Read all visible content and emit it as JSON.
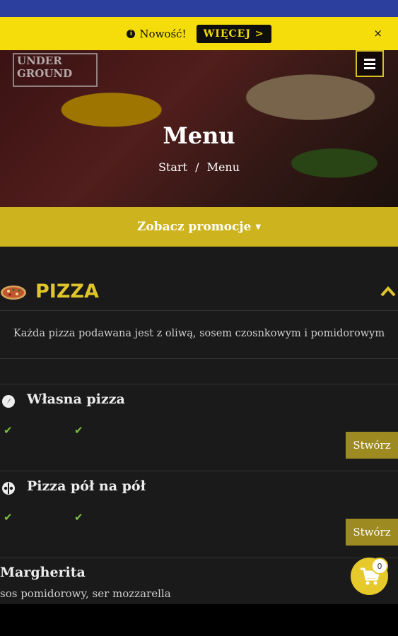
{
  "notice": {
    "text": "Nowość!",
    "button": "WIĘCEJ >",
    "close": "×"
  },
  "hero": {
    "logo_line1": "UNDER",
    "logo_line2": "GROUND",
    "title": "Menu",
    "breadcrumb": [
      "Start",
      "/",
      "Menu"
    ]
  },
  "promo": {
    "label": "Zobacz promocje"
  },
  "category": {
    "title": "PIZZA",
    "description": "Każda pizza podawana jest z oliwą, sosem czosnkowym i pomidorowym"
  },
  "items": [
    {
      "name": "Własna pizza",
      "button": "Stwórz",
      "icon": "compass-icon"
    },
    {
      "name": "Pizza pół na pół",
      "button": "Stwórz",
      "icon": "half-pizza-icon"
    }
  ],
  "margherita": {
    "name": "Margherita",
    "description": "sos pomidorowy, ser mozzarella"
  },
  "cart": {
    "count": "0"
  },
  "colors": {
    "accent": "#e0c52a",
    "promo": "#cdb31d",
    "notice": "#f5dc0b",
    "topbar": "#2c3e9e"
  }
}
